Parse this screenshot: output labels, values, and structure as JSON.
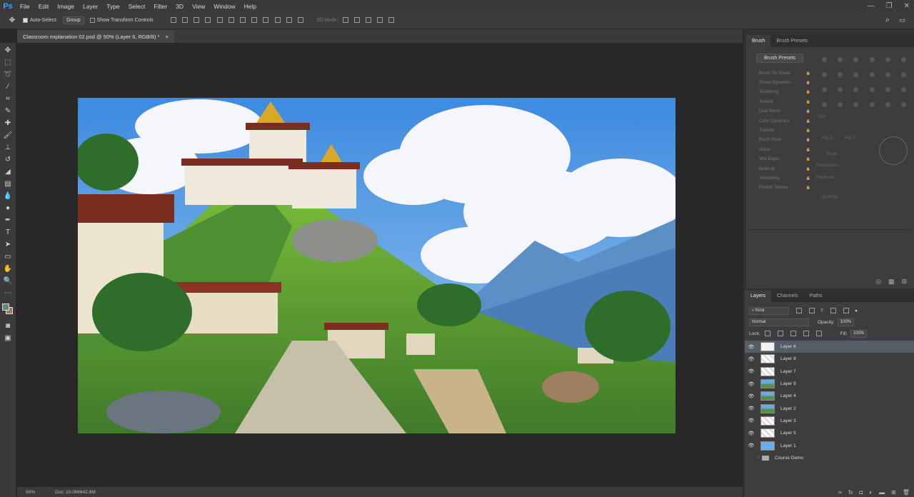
{
  "app": {
    "logo": "Ps"
  },
  "menu": [
    "File",
    "Edit",
    "Image",
    "Layer",
    "Type",
    "Select",
    "Filter",
    "3D",
    "View",
    "Window",
    "Help"
  ],
  "window_controls": {
    "minimize": "—",
    "restore": "❐",
    "close": "✕"
  },
  "options_bar": {
    "auto_select_label": "Auto-Select:",
    "auto_select_value": "Group",
    "show_transform_label": "Show Transform Controls",
    "mode_3d_label": "3D Mode:"
  },
  "document": {
    "tab_title": "Classroom explanation 02.psd @ 50% (Layer 6, RGB/8) *",
    "close": "×"
  },
  "status": {
    "zoom": "50%",
    "doc": "Doc: 10.0M/642.6M"
  },
  "colors": {
    "foreground": "#5c8a7c",
    "background": "#a0785a"
  },
  "brush_panel": {
    "tabs": [
      "Brush",
      "Brush Presets"
    ],
    "presets_button": "Brush Presets",
    "options": [
      "Brush Tip Shape",
      "Shape Dynamics",
      "Scattering",
      "Texture",
      "Dual Brush",
      "Color Dynamics",
      "Transfer",
      "Brush Pose",
      "Noise",
      "Wet Edges",
      "Build-up",
      "Smoothing",
      "Protect Texture"
    ],
    "size_label": "Size",
    "flip_x": "Flip X",
    "flip_y": "Flip Y",
    "angle": "Angle:",
    "roundness": "Roundness:",
    "hardness": "Hardness",
    "spacing": "Spacing"
  },
  "layers_panel": {
    "tabs": [
      "Layers",
      "Channels",
      "Paths"
    ],
    "filter_kind": "Kind",
    "blend_mode": "Normal",
    "opacity_label": "Opacity:",
    "opacity_value": "100%",
    "lock_label": "Lock:",
    "fill_label": "Fill:",
    "fill_value": "100%",
    "layers": [
      {
        "name": "Layer 6",
        "thumb": "white",
        "selected": true
      },
      {
        "name": "Layer 8",
        "thumb": "checker"
      },
      {
        "name": "Layer 7",
        "thumb": "checker"
      },
      {
        "name": "Layer 9",
        "thumb": "land"
      },
      {
        "name": "Layer 4",
        "thumb": "land"
      },
      {
        "name": "Layer 2",
        "thumb": "land"
      },
      {
        "name": "Layer 3",
        "thumb": "checker"
      },
      {
        "name": "Layer 5",
        "thumb": "checker"
      },
      {
        "name": "Layer 1",
        "thumb": "sky"
      }
    ],
    "group": "Course Demo"
  }
}
